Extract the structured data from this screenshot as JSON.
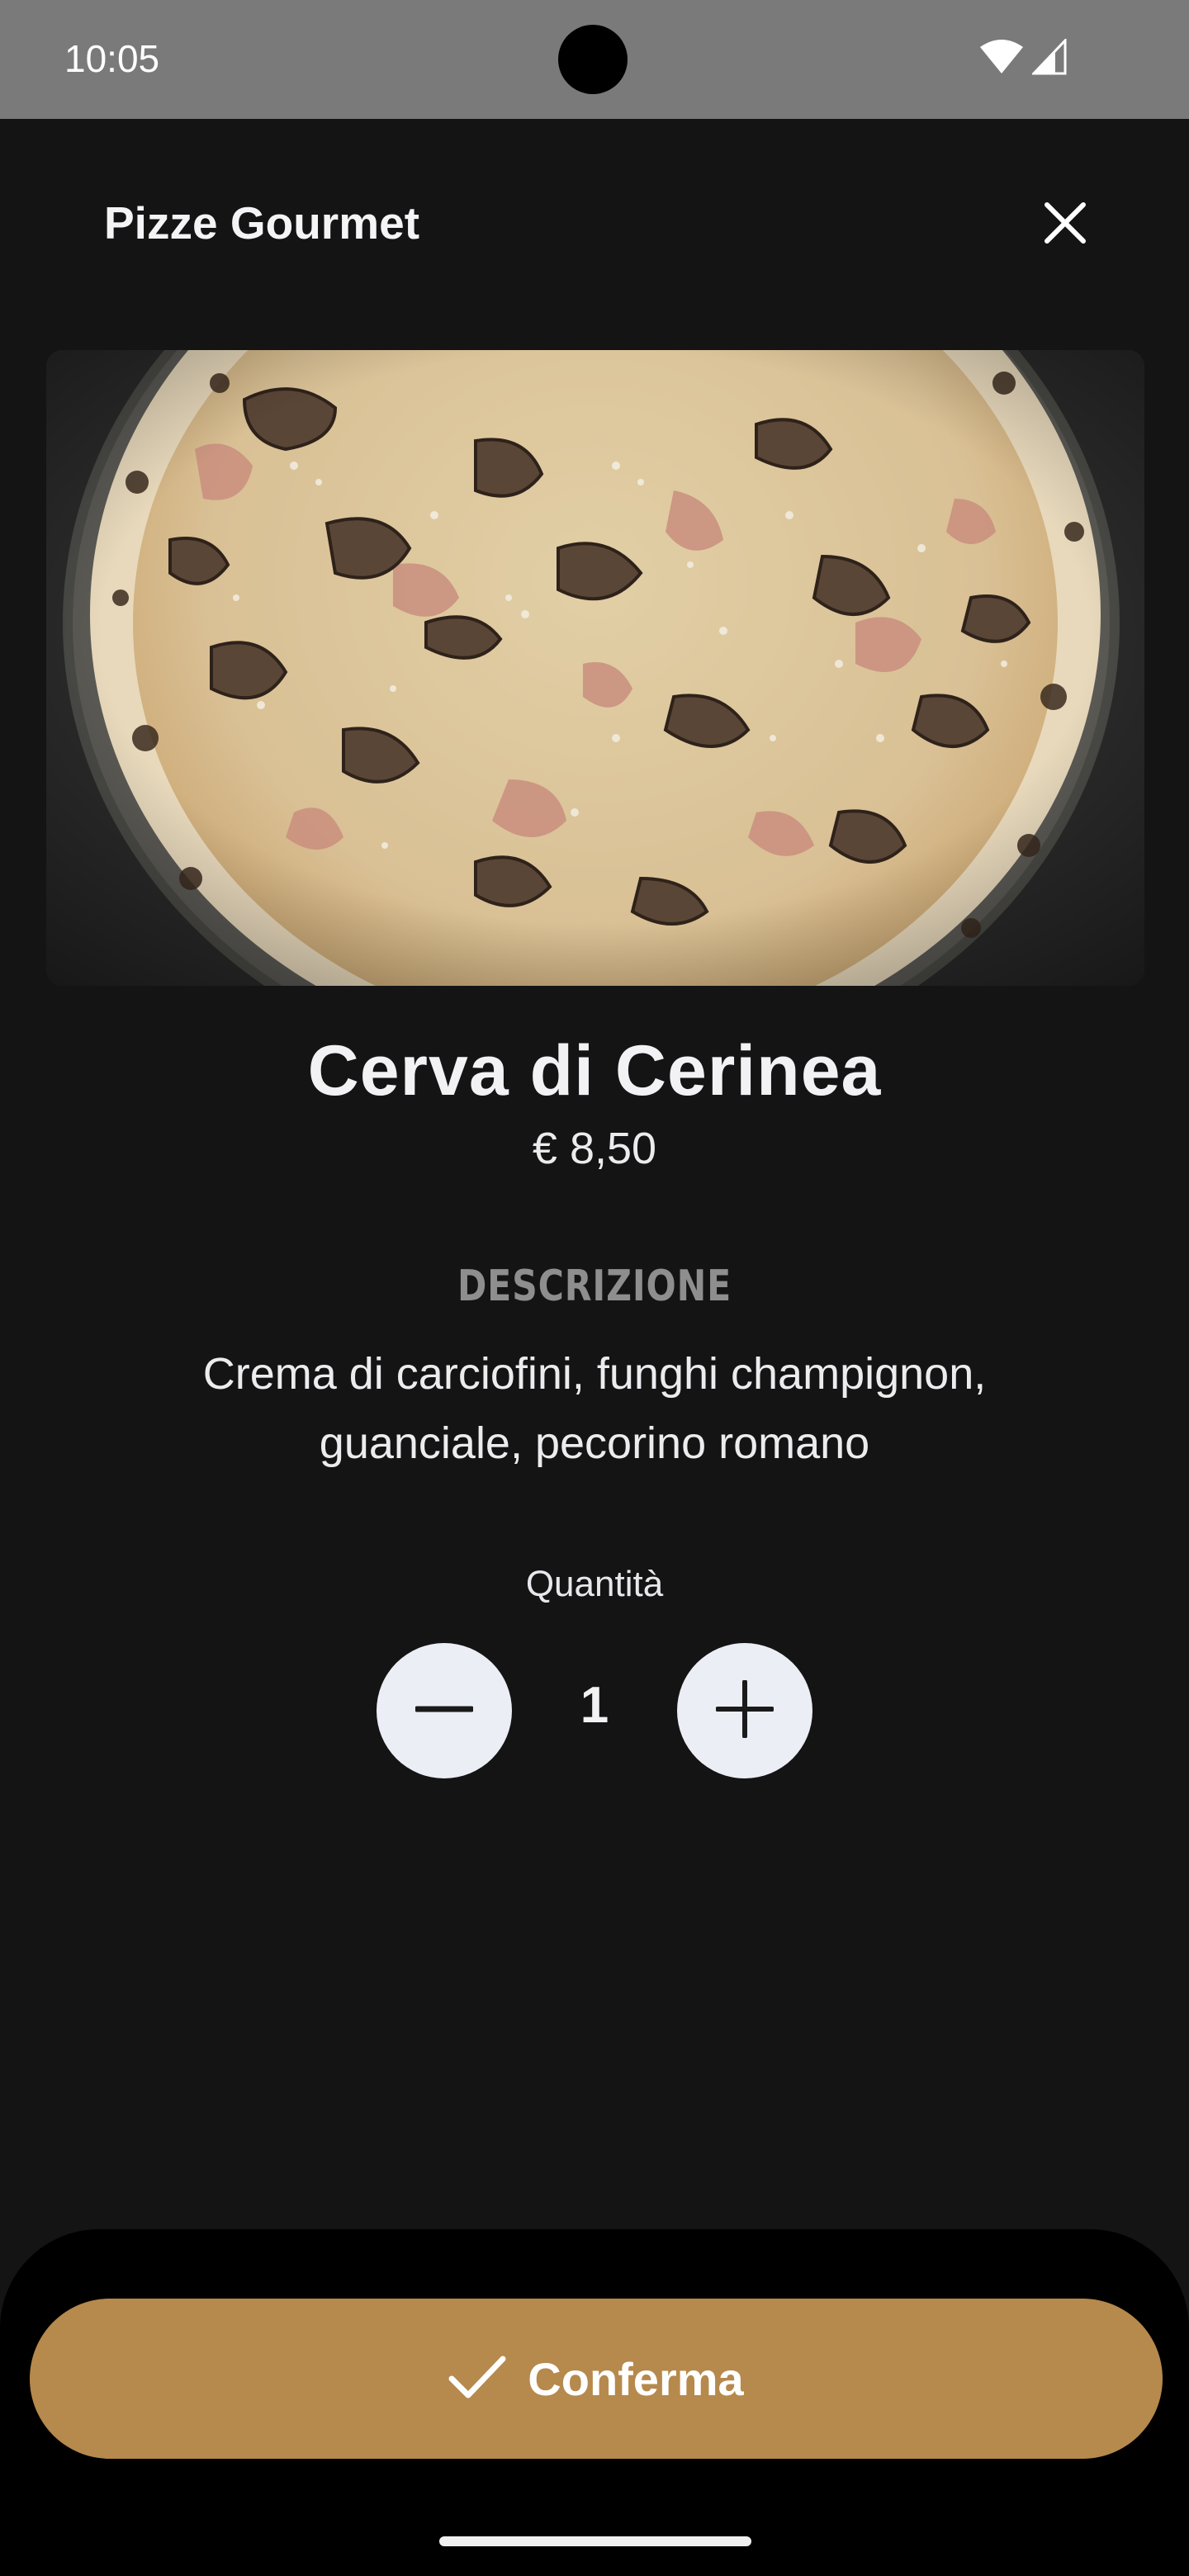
{
  "status_bar": {
    "time": "10:05"
  },
  "header": {
    "title": "Pizze Gourmet",
    "close_icon": "close-icon"
  },
  "product": {
    "image_icon": "pizza-photo",
    "name": "Cerva di Cerinea",
    "price": "€ 8,50",
    "description_label": "DESCRIZIONE",
    "description": "Crema di carciofini, funghi champignon, guanciale, pecorino romano"
  },
  "quantity": {
    "label": "Quantità",
    "value": "1",
    "minus_icon": "minus-icon",
    "plus_icon": "plus-icon"
  },
  "confirm": {
    "label": "Conferma",
    "icon": "check-icon"
  },
  "colors": {
    "background": "#141414",
    "accent": "#b6894c",
    "button_light": "#eceef6"
  }
}
